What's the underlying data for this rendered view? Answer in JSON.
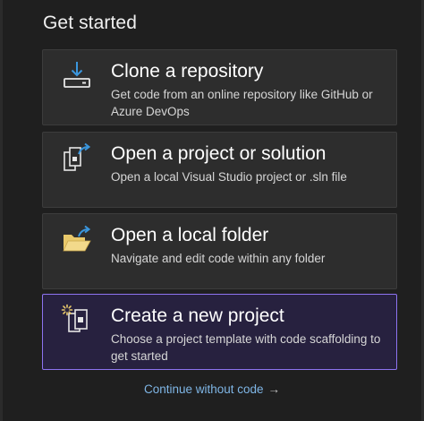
{
  "title": "Get started",
  "cards": [
    {
      "title": "Clone a repository",
      "description": "Get code from an online repository like GitHub or Azure DevOps",
      "icon": "clone-download-icon"
    },
    {
      "title": "Open a project or solution",
      "description": "Open a local Visual Studio project or .sln file",
      "icon": "open-project-icon"
    },
    {
      "title": "Open a local folder",
      "description": "Navigate and edit code within any folder",
      "icon": "open-folder-icon"
    },
    {
      "title": "Create a new project",
      "description": "Choose a project template with code scaffolding to get started",
      "icon": "new-project-icon",
      "selected": true
    }
  ],
  "continue_link": {
    "label": "Continue without code",
    "arrow": "→"
  },
  "colors": {
    "background": "#1f1f1f",
    "card": "#2d2d2d",
    "selected_card": "#27213f",
    "selected_border": "#8d73f0",
    "link": "#7fb6e6",
    "accent_blue": "#3a96dd",
    "folder_yellow": "#e8c86a"
  }
}
